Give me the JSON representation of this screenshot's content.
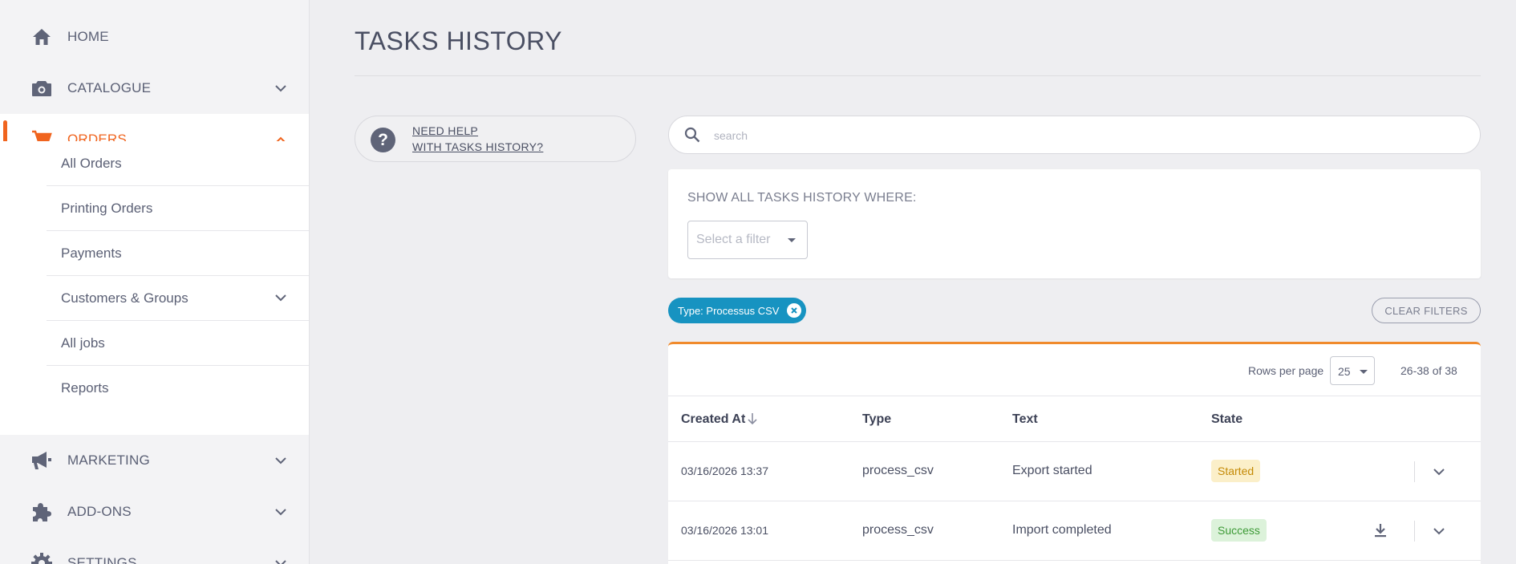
{
  "sidebar": {
    "nav": [
      {
        "label": "HOME",
        "icon": "home-icon"
      },
      {
        "label": "CATALOGUE",
        "icon": "camera-icon"
      },
      {
        "label": "ORDERS",
        "icon": "cart-icon"
      },
      {
        "label": "MARKETING",
        "icon": "megaphone-icon"
      },
      {
        "label": "ADD-ONS",
        "icon": "puzzle-icon"
      },
      {
        "label": "SETTINGS",
        "icon": "gear-icon"
      }
    ],
    "orders_submenu": [
      {
        "label": "All Orders"
      },
      {
        "label": "Printing Orders"
      },
      {
        "label": "Payments"
      },
      {
        "label": "Customers & Groups"
      },
      {
        "label": "All jobs"
      },
      {
        "label": "Reports"
      }
    ]
  },
  "header": {
    "title": "TASKS HISTORY"
  },
  "help": {
    "line1": "NEED HELP",
    "line2": "WITH TASKS HISTORY?"
  },
  "search": {
    "placeholder": "search",
    "value": ""
  },
  "filters": {
    "title": "SHOW ALL TASKS HISTORY WHERE:",
    "select_placeholder": "Select a filter",
    "active_chip": "Type: Processus CSV",
    "clear_label": "CLEAR FILTERS"
  },
  "pagination": {
    "rows_per_page_label": "Rows per page",
    "rows_per_page_value": "25",
    "range": "26-38 of 38"
  },
  "table": {
    "columns": {
      "created_at": "Created At",
      "type": "Type",
      "text": "Text",
      "state": "State"
    },
    "rows": [
      {
        "created_at": "03/16/2026 13:37",
        "type": "process_csv",
        "text": "Export started",
        "state": "Started"
      },
      {
        "created_at": "03/16/2026 13:01",
        "type": "process_csv",
        "text": "Import completed",
        "state": "Success"
      }
    ]
  },
  "colors": {
    "accent": "#f0641e",
    "chip": "#1793c1",
    "started_bg": "#fbefc9",
    "success_bg": "#dcf2da"
  }
}
